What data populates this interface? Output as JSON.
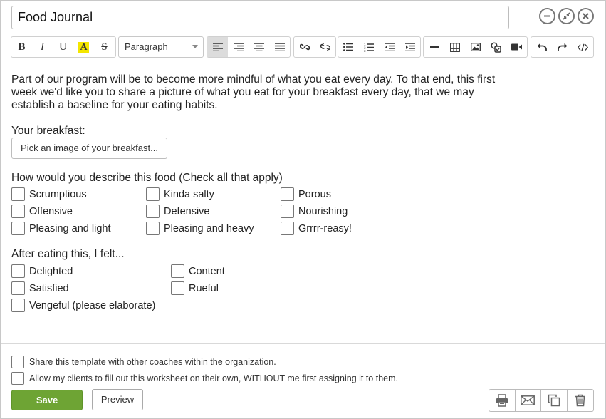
{
  "title": {
    "value": "Food Journal"
  },
  "toolbar": {
    "format_select": "Paragraph",
    "bold_glyph": "B",
    "italic_glyph": "I",
    "underline_glyph": "U",
    "highlight_glyph": "A",
    "strike_glyph": "S"
  },
  "content": {
    "intro": "Part of our program will be to become more mindful of what you eat every day. To that end, this first week we'd like you to share a picture of what you eat for your breakfast every day, that we may establish a baseline for your eating habits.",
    "breakfast_label": "Your breakfast:",
    "pick_image_button": "Pick an image of your breakfast...",
    "describe_label": "How would you describe this food (Check all that apply)",
    "describe_options": [
      "Scrumptious",
      "Kinda salty",
      "Porous",
      "Offensive",
      "Defensive",
      "Nourishing",
      "Pleasing and light",
      "Pleasing and heavy",
      "Grrrr-reasy!"
    ],
    "felt_label": "After eating this, I felt...",
    "felt_options": [
      "Delighted",
      "Content",
      "Satisfied",
      "Rueful",
      "Vengeful (please elaborate)"
    ]
  },
  "footer": {
    "share_option": "Share this template with other coaches within the organization.",
    "allow_option": "Allow my clients to fill out this worksheet on their own, WITHOUT me first assigning it to them.",
    "save_button": "Save",
    "preview_button": "Preview"
  },
  "colors": {
    "save_green": "#6ea434",
    "highlight_yellow": "#f4e600"
  }
}
